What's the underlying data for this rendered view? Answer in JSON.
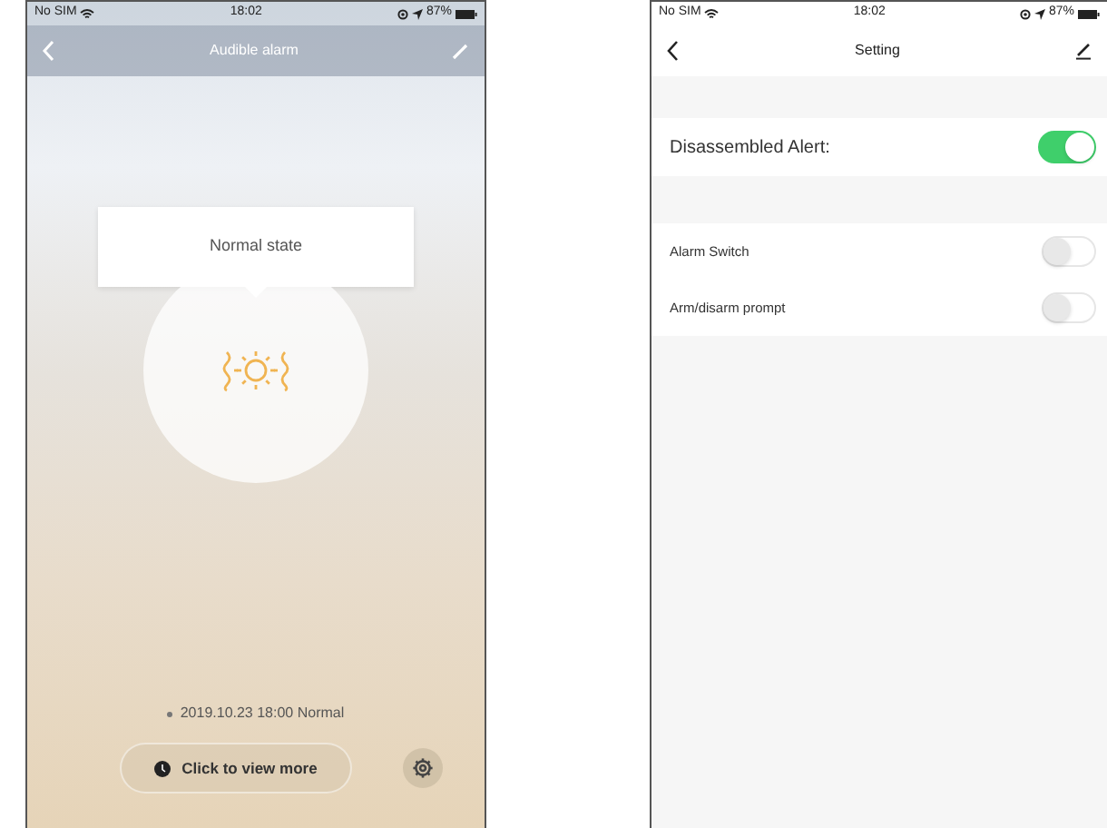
{
  "alarm_screen": {
    "status_bar": {
      "carrier": "No SIM",
      "time": "18:02",
      "battery": "87%"
    },
    "title": "Audible alarm",
    "popup": "Normal state",
    "last_event": "2019.10.23 18:00 Normal",
    "view_more_button": "Click to view more"
  },
  "settings_screen": {
    "status_bar": {
      "carrier": "No SIM",
      "time": "18:02",
      "battery": "87%"
    },
    "title": "Setting",
    "sections": [
      {
        "items": [
          {
            "label": "Disassembled Alert:",
            "on": true,
            "kind": "large"
          }
        ]
      },
      {
        "items": [
          {
            "label": "Alarm Switch",
            "on": false,
            "kind": "small"
          },
          {
            "label": "Arm/disarm prompt",
            "on": false,
            "kind": "small"
          }
        ]
      }
    ]
  }
}
